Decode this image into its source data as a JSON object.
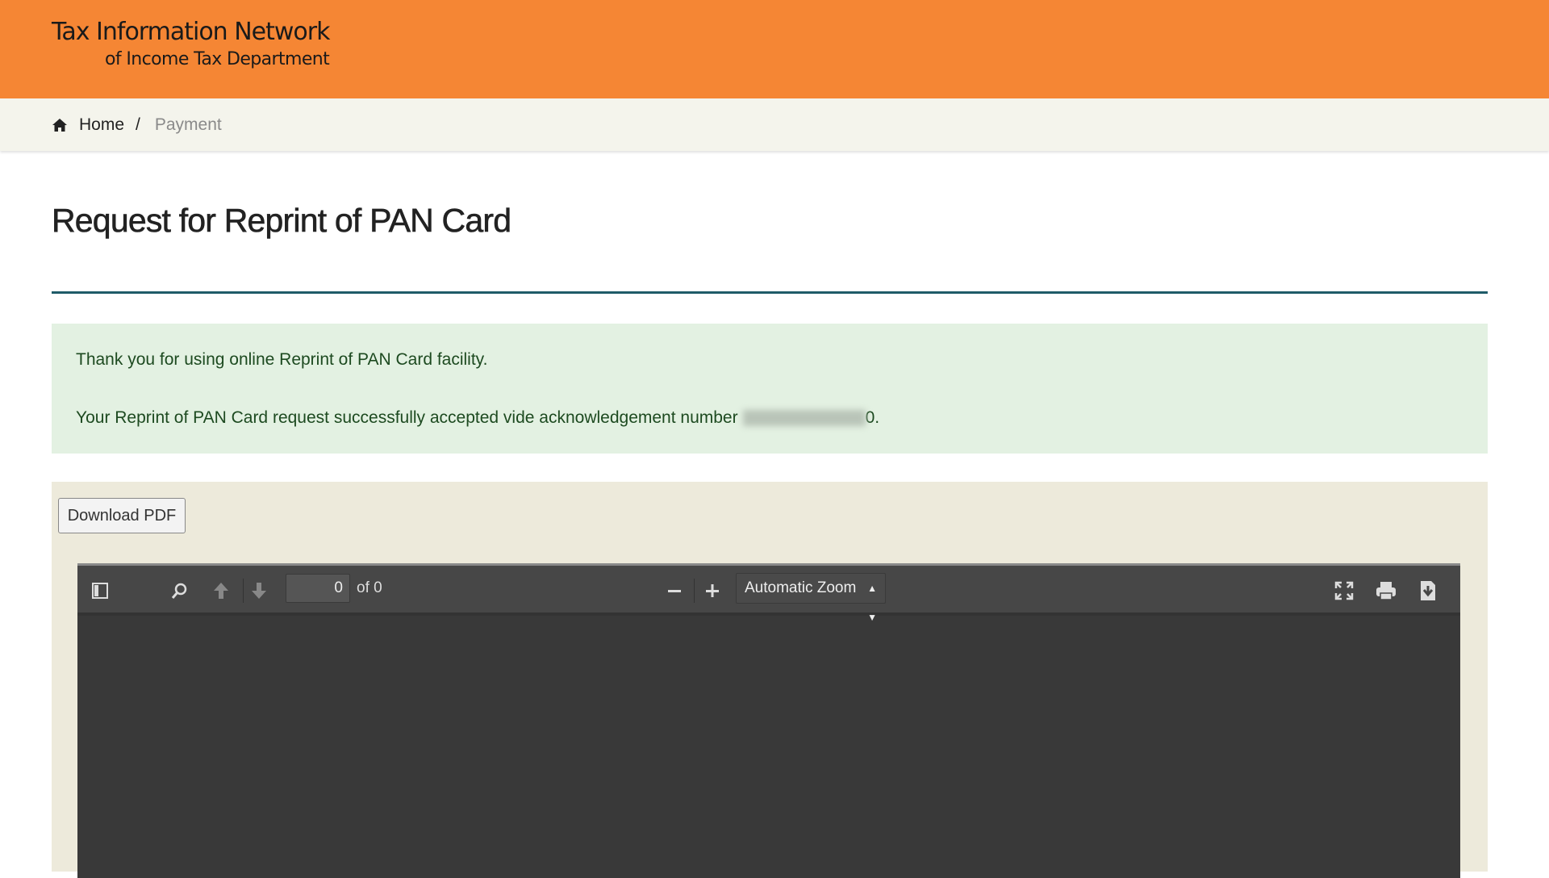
{
  "header": {
    "title_line1": "Tax Information Network",
    "title_line2": "of Income Tax Department",
    "color": "#F58634"
  },
  "breadcrumb": {
    "home": "Home",
    "separator": "/",
    "current": "Payment"
  },
  "page": {
    "title": "Request for Reprint of PAN Card"
  },
  "alert": {
    "line1": "Thank you for using online Reprint of PAN Card facility.",
    "line2_prefix": "Your Reprint of PAN Card request successfully accepted vide acknowledgement number",
    "ack_visible_suffix": "0."
  },
  "download_button": "Download PDF",
  "pdf_viewer": {
    "page_number": "0",
    "page_count": "of 0",
    "zoom": "Automatic Zoom",
    "icons": [
      "sidebar-toggle-icon",
      "search-icon",
      "previous-page-icon",
      "next-page-icon",
      "zoom-out-icon",
      "zoom-in-icon",
      "fullscreen-icon",
      "print-icon",
      "download-icon"
    ]
  }
}
